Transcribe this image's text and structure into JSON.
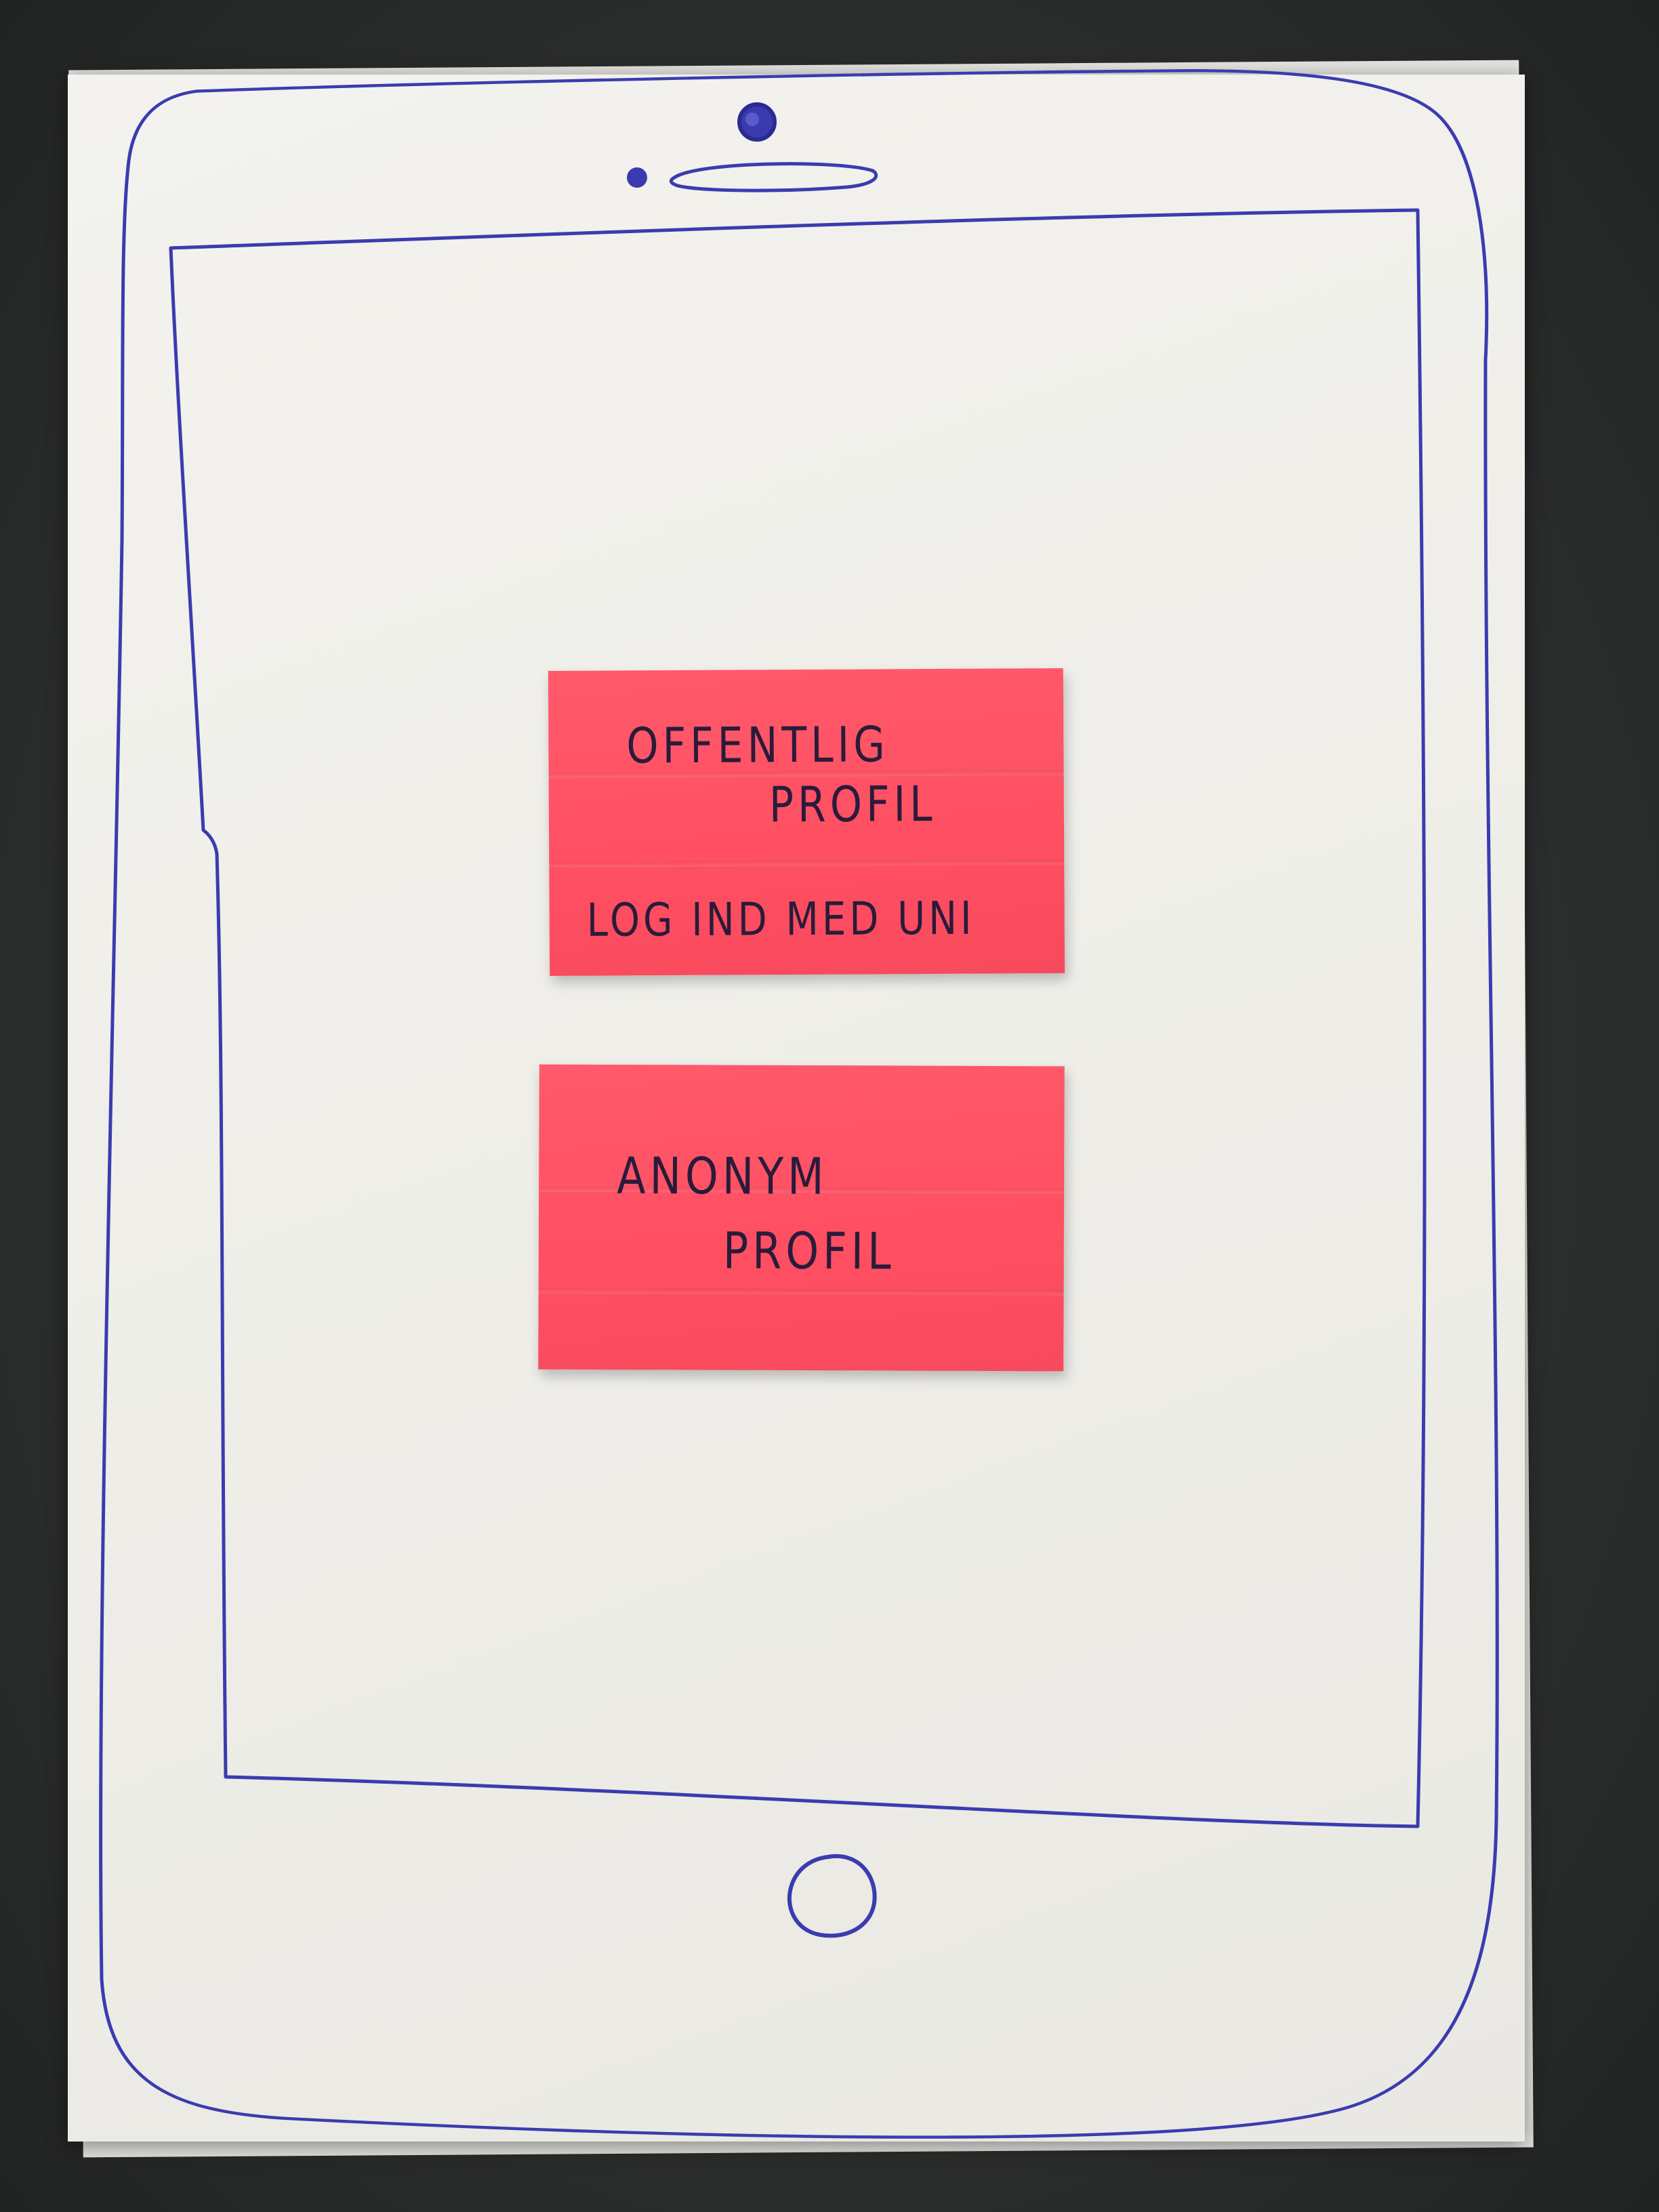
{
  "sketch": {
    "device": "tablet",
    "ink_color": "#3b3bb0",
    "note_color": "#ff5468",
    "icons": [
      "camera-icon",
      "sensor-dot-icon",
      "speaker-slot-icon",
      "home-button-icon"
    ]
  },
  "notes": {
    "public_profile": {
      "title_line1": "OFFENTLIG",
      "title_line2": "PROFIL",
      "action": "LOG IND MED UNI"
    },
    "anonymous_profile": {
      "title_line1": "ANONYM",
      "title_line2": "PROFIL"
    }
  }
}
